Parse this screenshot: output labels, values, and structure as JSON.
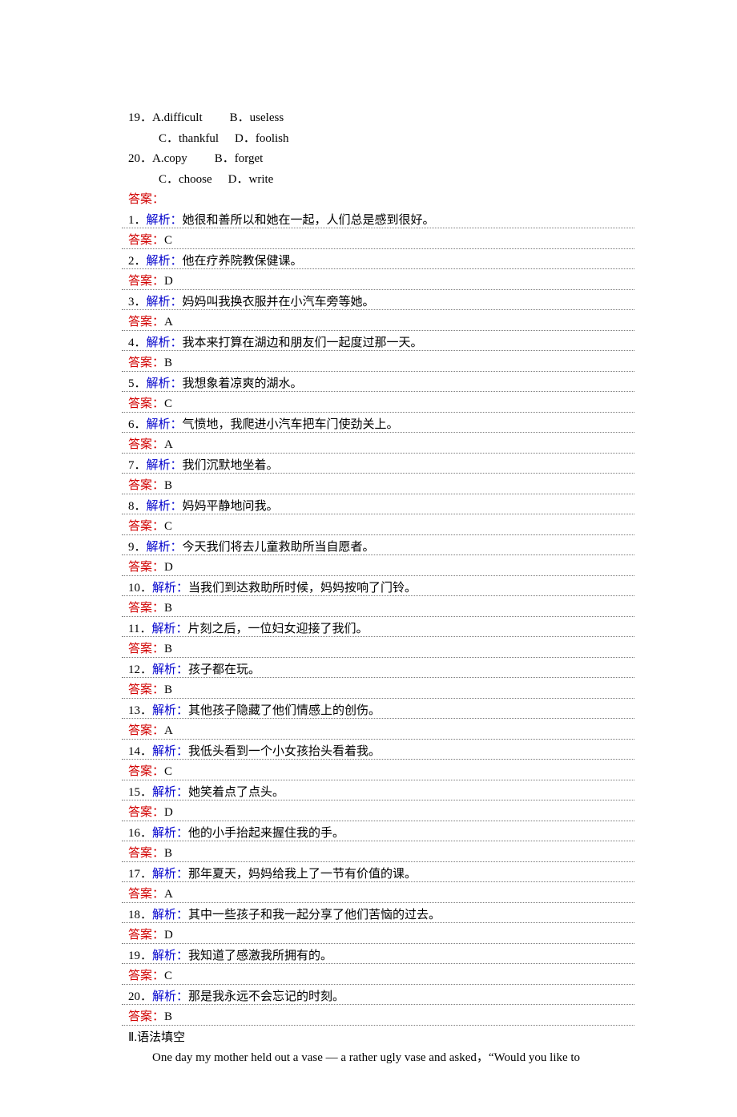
{
  "questions": [
    {
      "num": "19．",
      "a": "A.difficult",
      "b": "B．useless",
      "c": "C．thankful",
      "d": "D．foolish"
    },
    {
      "num": "20．",
      "a": "A.copy",
      "b": "B．forget",
      "c": "C．choose",
      "d": "D．write"
    }
  ],
  "answers_header": "答案：",
  "answers": [
    {
      "n": "1．",
      "jx": "解析：",
      "expl": "她很和善所以和她在一起，人们总是感到很好。",
      "ans_label": "答案：",
      "ans": "C"
    },
    {
      "n": "2．",
      "jx": "解析：",
      "expl": "他在疗养院教保健课。",
      "ans_label": "答案：",
      "ans": "D"
    },
    {
      "n": "3．",
      "jx": "解析：",
      "expl": "妈妈叫我换衣服并在小汽车旁等她。",
      "ans_label": "答案：",
      "ans": "A"
    },
    {
      "n": "4．",
      "jx": "解析：",
      "expl": "我本来打算在湖边和朋友们一起度过那一天。",
      "ans_label": "答案：",
      "ans": "B"
    },
    {
      "n": "5．",
      "jx": "解析：",
      "expl": "我想象着凉爽的湖水。",
      "ans_label": "答案：",
      "ans": "C"
    },
    {
      "n": "6．",
      "jx": "解析：",
      "expl": "气愤地，我爬进小汽车把车门使劲关上。",
      "ans_label": "答案：",
      "ans": "A"
    },
    {
      "n": "7．",
      "jx": "解析：",
      "expl": "我们沉默地坐着。",
      "ans_label": "答案：",
      "ans": "B"
    },
    {
      "n": "8．",
      "jx": "解析：",
      "expl": "妈妈平静地问我。",
      "ans_label": "答案：",
      "ans": "C"
    },
    {
      "n": "9．",
      "jx": "解析：",
      "expl": "今天我们将去儿童救助所当自愿者。",
      "ans_label": "答案：",
      "ans": "D"
    },
    {
      "n": "10．",
      "jx": "解析：",
      "expl": "当我们到达救助所时候，妈妈按响了门铃。",
      "ans_label": "答案：",
      "ans": "B"
    },
    {
      "n": "11．",
      "jx": "解析：",
      "expl": "片刻之后，一位妇女迎接了我们。",
      "ans_label": "答案：",
      "ans": "B"
    },
    {
      "n": "12．",
      "jx": "解析：",
      "expl": "孩子都在玩。",
      "ans_label": "答案：",
      "ans": "B"
    },
    {
      "n": "13．",
      "jx": "解析：",
      "expl": "其他孩子隐藏了他们情感上的创伤。",
      "ans_label": "答案：",
      "ans": "A"
    },
    {
      "n": "14．",
      "jx": "解析：",
      "expl": "我低头看到一个小女孩抬头看着我。",
      "ans_label": "答案：",
      "ans": "C"
    },
    {
      "n": "15．",
      "jx": "解析：",
      "expl": "她笑着点了点头。",
      "ans_label": "答案：",
      "ans": "D"
    },
    {
      "n": "16．",
      "jx": "解析：",
      "expl": "他的小手抬起来握住我的手。",
      "ans_label": "答案：",
      "ans": "B"
    },
    {
      "n": "17．",
      "jx": "解析：",
      "expl": "那年夏天，妈妈给我上了一节有价值的课。",
      "ans_label": "答案：",
      "ans": "A"
    },
    {
      "n": "18．",
      "jx": "解析：",
      "expl": "其中一些孩子和我一起分享了他们苦恼的过去。",
      "ans_label": "答案：",
      "ans": "D"
    },
    {
      "n": "19．",
      "jx": "解析：",
      "expl": "我知道了感激我所拥有的。",
      "ans_label": "答案：",
      "ans": "C"
    },
    {
      "n": "20．",
      "jx": "解析：",
      "expl": "那是我永远不会忘记的时刻。",
      "ans_label": "答案：",
      "ans": "B"
    }
  ],
  "grammar_section": "Ⅱ.语法填空",
  "paragraph": "One day my mother held out a vase — a rather ugly vase and asked，“Would you like to"
}
